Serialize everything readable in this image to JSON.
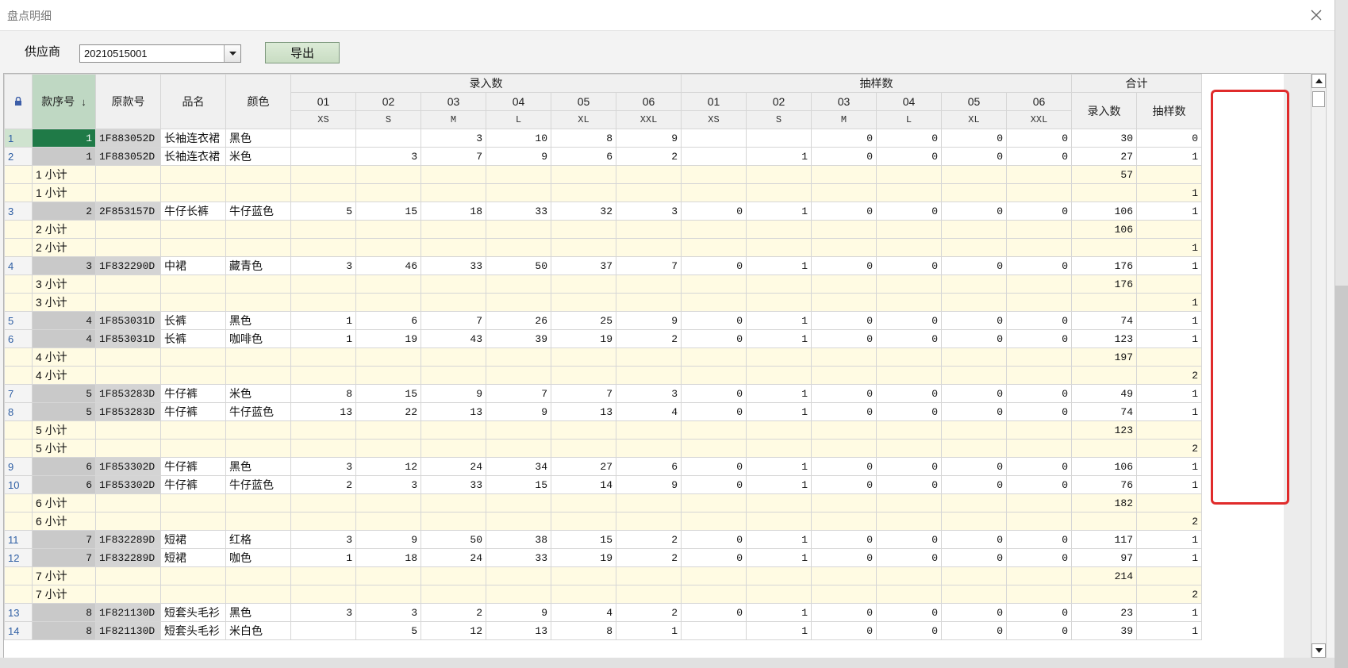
{
  "window": {
    "title": "盘点明细"
  },
  "toolbar": {
    "supplier_label": "供应商",
    "supplier_value": "20210515001",
    "export_label": "导出"
  },
  "colors": {
    "highlight": "#e02b2b",
    "selected_cell": "#1f7a47",
    "subtotal_row": "#fffbe3"
  },
  "grid": {
    "corner_icon": "lock-icon",
    "headers": {
      "seq": "款序号",
      "orig": "原款号",
      "name": "品名",
      "color": "颜色",
      "group_entry": "录入数",
      "group_sample": "抽样数",
      "group_total": "合计",
      "total_entry": "录入数",
      "total_sample": "抽样数",
      "size_codes": [
        "01",
        "02",
        "03",
        "04",
        "05",
        "06"
      ],
      "size_names": [
        "XS",
        "S",
        "M",
        "L",
        "XL",
        "XXL"
      ]
    },
    "rows": [
      {
        "rn": "1",
        "seq": "1",
        "orig": "1F883052D",
        "name": "长袖连衣裙",
        "color": "黑色",
        "e": [
          "",
          "",
          "3",
          "10",
          "8",
          "9"
        ],
        "s": [
          "",
          "",
          "0",
          "0",
          "0",
          "0"
        ],
        "te": "30",
        "ts": "0",
        "selected": true
      },
      {
        "rn": "2",
        "seq": "1",
        "orig": "1F883052D",
        "name": "长袖连衣裙",
        "color": "米色",
        "e": [
          "",
          "3",
          "7",
          "9",
          "6",
          "2"
        ],
        "s": [
          "",
          "1",
          "0",
          "0",
          "0",
          "0"
        ],
        "te": "27",
        "ts": "1"
      },
      {
        "sub": true,
        "label": "1 小计",
        "te": "57",
        "ts": ""
      },
      {
        "sub": true,
        "label": "1 小计",
        "te": "",
        "ts": "1"
      },
      {
        "rn": "3",
        "seq": "2",
        "orig": "2F853157D",
        "name": "牛仔长裤",
        "color": "牛仔蓝色",
        "e": [
          "5",
          "15",
          "18",
          "33",
          "32",
          "3"
        ],
        "s": [
          "0",
          "1",
          "0",
          "0",
          "0",
          "0"
        ],
        "te": "106",
        "ts": "1"
      },
      {
        "sub": true,
        "label": "2 小计",
        "te": "106",
        "ts": ""
      },
      {
        "sub": true,
        "label": "2 小计",
        "te": "",
        "ts": "1"
      },
      {
        "rn": "4",
        "seq": "3",
        "orig": "1F832290D",
        "name": "中裙",
        "color": "藏青色",
        "e": [
          "3",
          "46",
          "33",
          "50",
          "37",
          "7"
        ],
        "s": [
          "0",
          "1",
          "0",
          "0",
          "0",
          "0"
        ],
        "te": "176",
        "ts": "1"
      },
      {
        "sub": true,
        "label": "3 小计",
        "te": "176",
        "ts": ""
      },
      {
        "sub": true,
        "label": "3 小计",
        "te": "",
        "ts": "1"
      },
      {
        "rn": "5",
        "seq": "4",
        "orig": "1F853031D",
        "name": "长裤",
        "color": "黑色",
        "e": [
          "1",
          "6",
          "7",
          "26",
          "25",
          "9"
        ],
        "s": [
          "0",
          "1",
          "0",
          "0",
          "0",
          "0"
        ],
        "te": "74",
        "ts": "1"
      },
      {
        "rn": "6",
        "seq": "4",
        "orig": "1F853031D",
        "name": "长裤",
        "color": "咖啡色",
        "e": [
          "1",
          "19",
          "43",
          "39",
          "19",
          "2"
        ],
        "s": [
          "0",
          "1",
          "0",
          "0",
          "0",
          "0"
        ],
        "te": "123",
        "ts": "1"
      },
      {
        "sub": true,
        "label": "4 小计",
        "te": "197",
        "ts": ""
      },
      {
        "sub": true,
        "label": "4 小计",
        "te": "",
        "ts": "2"
      },
      {
        "rn": "7",
        "seq": "5",
        "orig": "1F853283D",
        "name": "牛仔裤",
        "color": "米色",
        "e": [
          "8",
          "15",
          "9",
          "7",
          "7",
          "3"
        ],
        "s": [
          "0",
          "1",
          "0",
          "0",
          "0",
          "0"
        ],
        "te": "49",
        "ts": "1"
      },
      {
        "rn": "8",
        "seq": "5",
        "orig": "1F853283D",
        "name": "牛仔裤",
        "color": "牛仔蓝色",
        "e": [
          "13",
          "22",
          "13",
          "9",
          "13",
          "4"
        ],
        "s": [
          "0",
          "1",
          "0",
          "0",
          "0",
          "0"
        ],
        "te": "74",
        "ts": "1"
      },
      {
        "sub": true,
        "label": "5 小计",
        "te": "123",
        "ts": ""
      },
      {
        "sub": true,
        "label": "5 小计",
        "te": "",
        "ts": "2"
      },
      {
        "rn": "9",
        "seq": "6",
        "orig": "1F853302D",
        "name": "牛仔裤",
        "color": "黑色",
        "e": [
          "3",
          "12",
          "24",
          "34",
          "27",
          "6"
        ],
        "s": [
          "0",
          "1",
          "0",
          "0",
          "0",
          "0"
        ],
        "te": "106",
        "ts": "1"
      },
      {
        "rn": "10",
        "seq": "6",
        "orig": "1F853302D",
        "name": "牛仔裤",
        "color": "牛仔蓝色",
        "e": [
          "2",
          "3",
          "33",
          "15",
          "14",
          "9"
        ],
        "s": [
          "0",
          "1",
          "0",
          "0",
          "0",
          "0"
        ],
        "te": "76",
        "ts": "1"
      },
      {
        "sub": true,
        "label": "6 小计",
        "te": "182",
        "ts": ""
      },
      {
        "sub": true,
        "label": "6 小计",
        "te": "",
        "ts": "2"
      },
      {
        "rn": "11",
        "seq": "7",
        "orig": "1F832289D",
        "name": "短裙",
        "color": "红格",
        "e": [
          "3",
          "9",
          "50",
          "38",
          "15",
          "2"
        ],
        "s": [
          "0",
          "1",
          "0",
          "0",
          "0",
          "0"
        ],
        "te": "117",
        "ts": "1"
      },
      {
        "rn": "12",
        "seq": "7",
        "orig": "1F832289D",
        "name": "短裙",
        "color": "咖色",
        "e": [
          "1",
          "18",
          "24",
          "33",
          "19",
          "2"
        ],
        "s": [
          "0",
          "1",
          "0",
          "0",
          "0",
          "0"
        ],
        "te": "97",
        "ts": "1"
      },
      {
        "sub": true,
        "label": "7 小计",
        "te": "214",
        "ts": ""
      },
      {
        "sub": true,
        "label": "7 小计",
        "te": "",
        "ts": "2"
      },
      {
        "rn": "13",
        "seq": "8",
        "orig": "1F821130D",
        "name": "短套头毛衫",
        "color": "黑色",
        "e": [
          "3",
          "3",
          "2",
          "9",
          "4",
          "2"
        ],
        "s": [
          "0",
          "1",
          "0",
          "0",
          "0",
          "0"
        ],
        "te": "23",
        "ts": "1"
      },
      {
        "rn": "14",
        "seq": "8",
        "orig": "1F821130D",
        "name": "短套头毛衫",
        "color": "米白色",
        "e": [
          "",
          "5",
          "12",
          "13",
          "8",
          "1"
        ],
        "s": [
          "",
          "1",
          "0",
          "0",
          "0",
          "0"
        ],
        "te": "39",
        "ts": "1"
      }
    ]
  }
}
